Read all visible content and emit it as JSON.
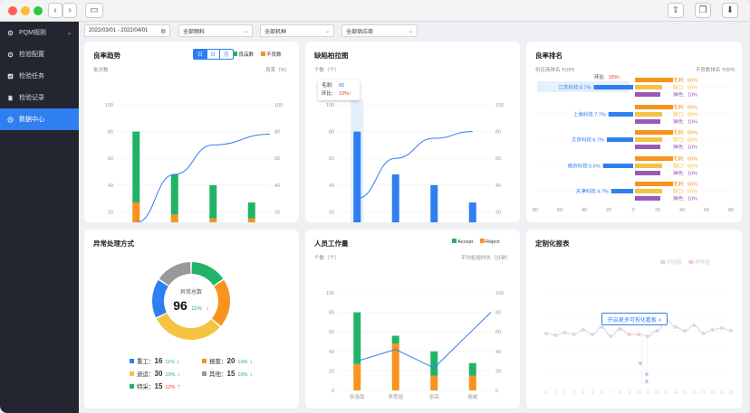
{
  "sidebar": {
    "items": [
      {
        "label": "PQM规则",
        "icon": "gear-icon",
        "expand": "chevron-down-icon"
      },
      {
        "label": "检验配置",
        "icon": "gear-icon"
      },
      {
        "label": "检验任务",
        "icon": "checklist-icon"
      },
      {
        "label": "检验记录",
        "icon": "document-icon"
      },
      {
        "label": "数据中心",
        "icon": "data-center-icon"
      }
    ]
  },
  "filters": {
    "date_range": "2022/03/01 - 2022/04/01",
    "material": "全部物料",
    "model": "全部机种",
    "supplier": "全部供应商"
  },
  "cards": {
    "yield_trend": {
      "title": "良率趋势",
      "toggle": [
        "日",
        "日",
        "月"
      ],
      "legend_good": "良品数",
      "legend_bad": "不良数",
      "y_left_label": "批次数",
      "y_right_label": "良率（%）"
    },
    "defect_pareto": {
      "title": "缺陷柏拉图",
      "y_left_label": "个数（个）",
      "tip_count_label": "毛刺:",
      "tip_count_value": "80",
      "tip_ratio_label": "环比:",
      "tip_ratio_value": "10%"
    },
    "yield_rank": {
      "title": "良率排名",
      "left_label": "供应商排名 TOP5",
      "right_label": "不良数排名 TOP5",
      "tip_label": "环比",
      "tip_value": "16%"
    },
    "exception": {
      "title": "异常处理方式",
      "center_label": "异常总数",
      "center_value": "96",
      "center_ratio": "11%",
      "items": [
        {
          "name": "重工",
          "value": "16",
          "ratio": "11%",
          "trend": "down",
          "color": "#2f7ff0"
        },
        {
          "name": "报废",
          "value": "20",
          "ratio": "10%",
          "trend": "down",
          "color": "#f7931e"
        },
        {
          "name": "退运",
          "value": "30",
          "ratio": "10%",
          "trend": "down",
          "color": "#f5c342"
        },
        {
          "name": "其他",
          "value": "15",
          "ratio": "10%",
          "trend": "down",
          "color": "#999999"
        },
        {
          "name": "特采",
          "value": "15",
          "ratio": "12%",
          "trend": "up",
          "color": "#21b468"
        }
      ]
    },
    "staff": {
      "title": "人员工作量",
      "legend_accept": "Accept",
      "legend_reject": "Reject",
      "y_left_label": "个数（个）",
      "y_right_label": "平均检验时长（分钟）"
    },
    "custom": {
      "title": "定制化报表",
      "legend_a": "均测值",
      "legend_b": "异常值",
      "button": "开启更多可视化看板 >"
    }
  },
  "chart_data": [
    {
      "type": "bar",
      "title": "良率趋势",
      "categories": [
        "03/01",
        "03/02",
        "03/03",
        "03/04"
      ],
      "series": [
        {
          "name": "良品数",
          "values": [
            80,
            48,
            40,
            27
          ]
        },
        {
          "name": "不良数",
          "values": [
            27,
            18,
            15,
            15
          ]
        }
      ],
      "line": {
        "values": [
          12,
          48,
          70,
          78
        ]
      },
      "ylim": [
        0,
        100
      ],
      "yticks": [
        0,
        20,
        40,
        60,
        80,
        100
      ]
    },
    {
      "type": "bar",
      "title": "缺陷柏拉图",
      "categories": [
        "毛刺",
        "破损",
        "断裂",
        "掉色"
      ],
      "values": [
        80,
        48,
        40,
        27
      ],
      "line": [
        30,
        60,
        75,
        80
      ],
      "ylim": [
        0,
        100
      ],
      "yticks": [
        0,
        20,
        40,
        60,
        80,
        100
      ]
    },
    {
      "type": "bar",
      "title": "良率排名",
      "suppliers": [
        {
          "name": "江苏科技:8.7%",
          "value": 72
        },
        {
          "name": "上海科技:7.7%",
          "value": 45
        },
        {
          "name": "文京科技:6.7%",
          "value": 48
        },
        {
          "name": "南京科技:5.6%",
          "value": 55
        },
        {
          "name": "天津科技:4.7%",
          "value": 40
        }
      ],
      "defects": [
        {
          "label": "毛刺:",
          "value": "60%"
        },
        {
          "label": "缺口:",
          "value": "50%"
        },
        {
          "label": "掉色:",
          "value": "10%"
        }
      ],
      "xticks": [
        80,
        60,
        40,
        20,
        0,
        20,
        40,
        60,
        80
      ]
    },
    {
      "type": "pie",
      "title": "异常处理方式",
      "values": [
        16,
        20,
        30,
        15,
        15
      ]
    },
    {
      "type": "bar",
      "title": "人员工作量",
      "categories": [
        "张洛南",
        "李思瑶",
        "张高",
        "谢威"
      ],
      "series": [
        {
          "name": "Accept",
          "values": [
            80,
            30,
            40,
            28
          ]
        },
        {
          "name": "Reject",
          "values": [
            27,
            48,
            15,
            15
          ]
        }
      ],
      "line": [
        30,
        42,
        23,
        80
      ],
      "ylim": [
        0,
        100
      ],
      "yticks": [
        0,
        20,
        40,
        60,
        80,
        100
      ]
    },
    {
      "type": "line",
      "title": "定制化报表",
      "xticks": [
        "0",
        "1",
        "2",
        "3",
        "4",
        "5",
        "6",
        "7",
        "8",
        "9",
        "10",
        "11",
        "12",
        "13",
        "14",
        "15",
        "16",
        "17",
        "18",
        "19",
        "20"
      ]
    }
  ]
}
